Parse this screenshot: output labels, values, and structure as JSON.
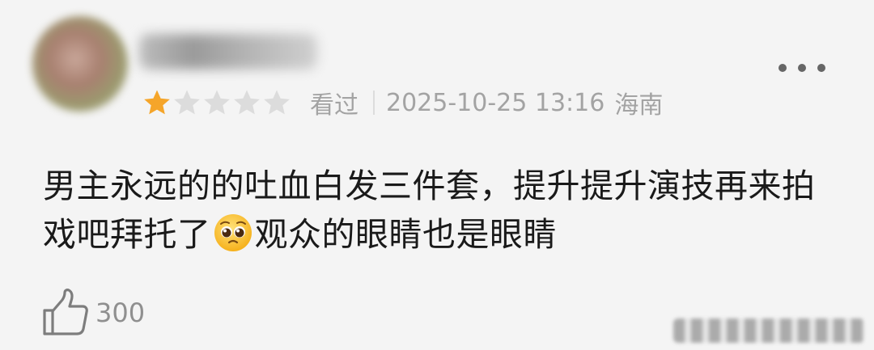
{
  "review": {
    "rating": 1,
    "rating_max": 5,
    "watched_label": "看过",
    "datetime": "2025-10-25 13:16",
    "location": "海南",
    "content_part1": "男主永远的的吐血白发三件套，提升提升演技再来拍戏吧拜托了",
    "emoji_name": "pleading-face-emoji",
    "content_part2": "观众的眼睛也是眼睛",
    "likes": "300"
  },
  "icons": {
    "more": "more-dots-icon",
    "like": "thumbs-up-icon",
    "star": "star-icon"
  },
  "colors": {
    "star_active": "#f5a52a",
    "star_inactive": "#dcdcdc",
    "meta_text": "#a3a3a3",
    "content_text": "#1a1a1a",
    "like_count_text": "#8f8f8f"
  }
}
